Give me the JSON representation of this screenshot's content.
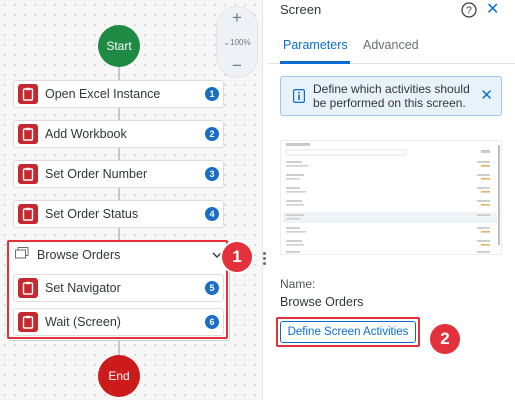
{
  "canvas": {
    "zoom": {
      "plus": "+",
      "level": "100%",
      "minus": "−"
    },
    "start_label": "Start",
    "end_label": "End",
    "activities": [
      {
        "label": "Open Excel Instance",
        "step": "1"
      },
      {
        "label": "Add Workbook",
        "step": "2"
      },
      {
        "label": "Set Order Number",
        "step": "3"
      },
      {
        "label": "Set Order Status",
        "step": "4"
      }
    ],
    "group": {
      "title": "Browse Orders",
      "items": [
        {
          "label": "Set Navigator",
          "step": "5"
        },
        {
          "label": "Wait (Screen)",
          "step": "6"
        }
      ]
    },
    "callout": "1"
  },
  "panel": {
    "title": "Screen",
    "tabs": {
      "parameters": "Parameters",
      "advanced": "Advanced"
    },
    "info": "Define which activities should be performed on this screen.",
    "name_label": "Name:",
    "name_value": "Browse Orders",
    "define_button": "Define Screen Activities",
    "callout": "2"
  },
  "colors": {
    "start": "#1e8a43",
    "end": "#cc1b1b",
    "activity_icon": "#c5282e",
    "step_badge": "#1a6ec5",
    "accent": "#0a6ed1",
    "highlight": "#e2313b"
  },
  "icons": {
    "activity": "clipboard-icon",
    "group": "window-icon",
    "help": "help-icon",
    "info": "info-icon",
    "close": "close-icon"
  }
}
